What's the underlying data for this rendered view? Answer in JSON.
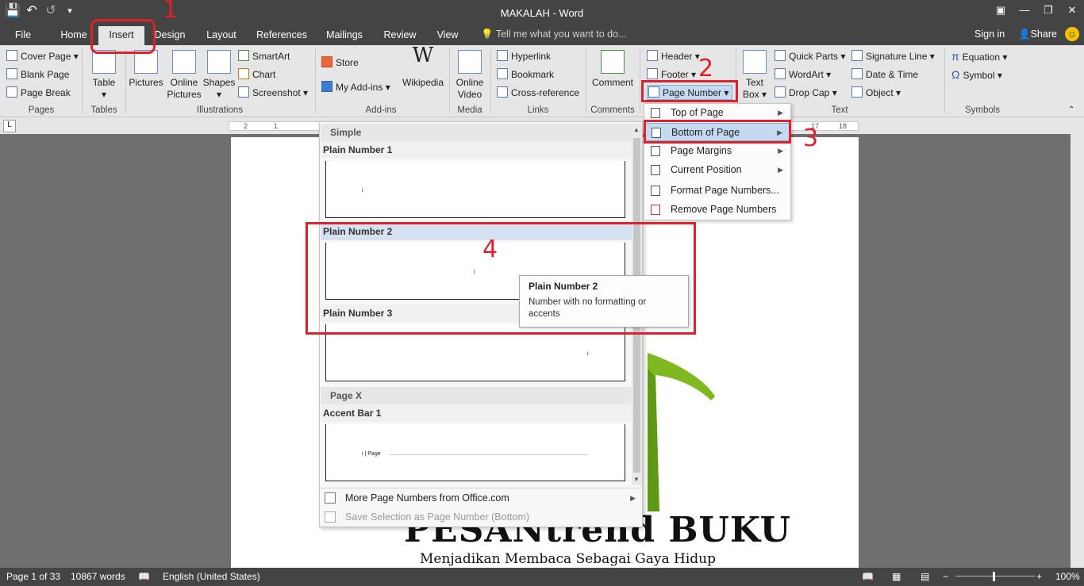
{
  "titlebar": {
    "title": "MAKALAH - Word"
  },
  "tabs": [
    "File",
    "Home",
    "Insert",
    "Design",
    "Layout",
    "References",
    "Mailings",
    "Review",
    "View"
  ],
  "tellme": "Tell me what you want to do...",
  "account": {
    "signin": "Sign in",
    "share": "Share"
  },
  "ribbon": {
    "pages": {
      "cover": "Cover Page",
      "blank": "Blank Page",
      "break": "Page Break",
      "group": "Pages"
    },
    "tables": {
      "table": "Table",
      "group": "Tables"
    },
    "illustrations": {
      "pictures": "Pictures",
      "online1": "Online",
      "online2": "Pictures",
      "shapes": "Shapes",
      "smartart": "SmartArt",
      "chart": "Chart",
      "screenshot": "Screenshot",
      "group": "Illustrations"
    },
    "addins": {
      "store": "Store",
      "myaddins": "My Add-ins",
      "wikipedia": "Wikipedia",
      "group": "Add-ins"
    },
    "media": {
      "video1": "Online",
      "video2": "Video",
      "group": "Media"
    },
    "links": {
      "hyperlink": "Hyperlink",
      "bookmark": "Bookmark",
      "crossref": "Cross-reference",
      "group": "Links"
    },
    "comments": {
      "comment": "Comment",
      "group": "Comments"
    },
    "headerfooter": {
      "header": "Header",
      "footer": "Footer",
      "pagenumber": "Page Number"
    },
    "text": {
      "textbox1": "Text",
      "textbox2": "Box",
      "quickparts": "Quick Parts",
      "wordart": "WordArt",
      "dropcap": "Drop Cap",
      "sigline": "Signature Line",
      "datetime": "Date & Time",
      "object": "Object",
      "group": "Text"
    },
    "symbols": {
      "equation": "Equation",
      "symbol": "Symbol",
      "group": "Symbols"
    }
  },
  "ruler": {
    "left": [
      "2",
      "1"
    ],
    "right": [
      "17",
      "18"
    ]
  },
  "page_number_menu": [
    {
      "label": "Top of Page",
      "submenu": true
    },
    {
      "label": "Bottom of Page",
      "submenu": true
    },
    {
      "label": "Page Margins",
      "submenu": true
    },
    {
      "label": "Current Position",
      "submenu": true
    },
    {
      "label": "Format Page Numbers...",
      "submenu": false
    },
    {
      "label": "Remove Page Numbers",
      "submenu": false
    }
  ],
  "gallery": {
    "section_simple": "Simple",
    "items": [
      {
        "label": "Plain Number 1",
        "num": "i"
      },
      {
        "label": "Plain Number 2",
        "num": "i"
      },
      {
        "label": "Plain Number 3",
        "num": "i"
      }
    ],
    "section_pagex": "Page X",
    "accent": {
      "label": "Accent Bar 1",
      "num": "i | Page"
    },
    "more": "More Page Numbers from Office.com",
    "save": "Save Selection as Page Number (Bottom)"
  },
  "tooltip": {
    "title": "Plain Number 2",
    "desc": "Number with no formatting or accents"
  },
  "document": {
    "logo_title": "PESANtrend BUKU",
    "logo_sub": "Menjadikan Membaca Sebagai Gaya Hidup"
  },
  "status": {
    "page": "Page 1 of 33",
    "words": "10867 words",
    "lang": "English (United States)",
    "zoom": "100%"
  },
  "annotations": [
    "1",
    "2",
    "3",
    "4"
  ],
  "colors": {
    "accent_red": "#e0202b",
    "titlebar": "#444444",
    "hover": "#c5d9f1"
  }
}
